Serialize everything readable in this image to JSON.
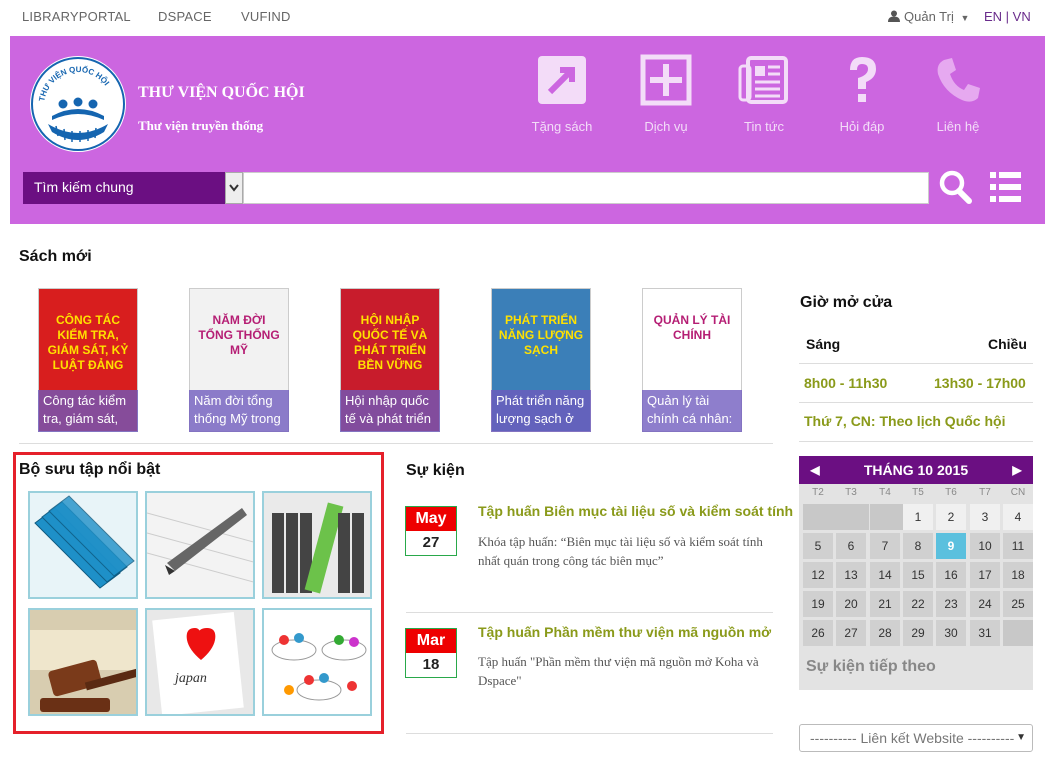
{
  "topnav": {
    "links": [
      "LIBRARYPORTAL",
      "DSPACE",
      "VUFIND"
    ],
    "user_label": "Quản Trị",
    "lang": "EN | VN"
  },
  "header": {
    "title": "THƯ VIỆN QUỐC HỘI",
    "subtitle": "Thư viện truyền thống",
    "logo_text": "THƯ VIỆN QUỐC HỘI",
    "nav": [
      {
        "label": "Tặng sách",
        "icon": "gift-book-icon"
      },
      {
        "label": "Dịch vụ",
        "icon": "plus-box-icon"
      },
      {
        "label": "Tin tức",
        "icon": "newspaper-icon"
      },
      {
        "label": "Hỏi đáp",
        "icon": "question-icon"
      },
      {
        "label": "Liên hệ",
        "icon": "phone-icon"
      }
    ]
  },
  "search": {
    "type_selected": "Tìm kiếm chung",
    "placeholder": ""
  },
  "new_books": {
    "title": "Sách mới",
    "items": [
      {
        "caption": "Công tác kiểm tra, giám sát,",
        "cover_title": "CÔNG TÁC KIỂM TRA, GIÁM SÁT, KỶ LUẬT ĐẢNG",
        "color": "#d81e1e"
      },
      {
        "caption": "Năm đời tổng thống Mỹ trong",
        "cover_title": "NĂM ĐỜI TỔNG THỐNG MỸ",
        "color": "#f2f2f2"
      },
      {
        "caption": "Hội nhập quốc tế và phát triển",
        "cover_title": "HỘI NHẬP QUỐC TẾ VÀ PHÁT TRIỂN BỀN VỮNG",
        "color": "#c81c2c"
      },
      {
        "caption": "Phát triển năng lượng sạch ở",
        "cover_title": "PHÁT TRIỂN NĂNG LƯỢNG SẠCH",
        "color": "#3b7fb8"
      },
      {
        "caption": "Quản lý tài chính cá nhân:",
        "cover_title": "QUẢN LÝ TÀI CHÍNH",
        "color": "#ffffff"
      }
    ]
  },
  "collections": {
    "title": "Bộ sưu tập nổi bật",
    "items": [
      "books-thumb",
      "pen-thumb",
      "binders-thumb",
      "gavel-thumb",
      "i-love-japan-thumb",
      "network-thumb"
    ]
  },
  "events": {
    "title": "Sự kiện",
    "items": [
      {
        "month": "May",
        "day": "27",
        "title": "Tập huấn Biên mục tài liệu số và kiểm soát tính",
        "desc": "Khóa tập huấn: “Biên mục tài liệu số và kiểm soát tính nhất quán trong công tác biên mục”"
      },
      {
        "month": "Mar",
        "day": "18",
        "title": "Tập huấn Phần mềm thư viện mã nguồn mở",
        "desc": "Tập huấn \"Phần mềm thư viện mã nguồn mở Koha và Dspace\""
      }
    ]
  },
  "hours": {
    "title": "Giờ mở cửa",
    "morning_label": "Sáng",
    "afternoon_label": "Chiều",
    "morning": "8h00 - 11h30",
    "afternoon": "13h30 - 17h00",
    "weekend": "Thứ 7, CN: Theo lịch Quốc hội"
  },
  "calendar": {
    "title": "THÁNG 10 2015",
    "dows": [
      "T2",
      "T3",
      "T4",
      "T5",
      "T6",
      "T7",
      "CN"
    ],
    "leading_blanks": 3,
    "days_in_month": 31,
    "today": 9,
    "next_events": "Sự kiện tiếp theo"
  },
  "weblinks": {
    "placeholder": "---------- Liên kết Website ----------"
  }
}
